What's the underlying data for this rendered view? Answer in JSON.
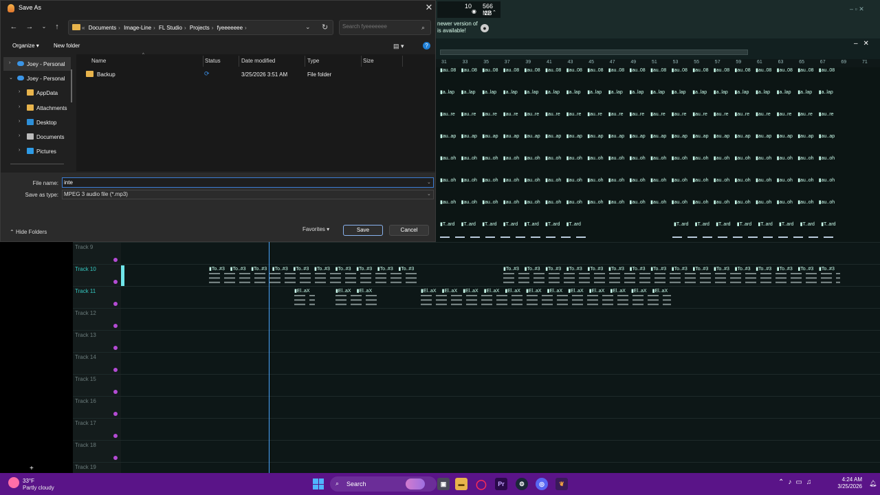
{
  "dialog": {
    "title": "Save As",
    "address": {
      "crumbs": [
        "Documents",
        "Image-Line",
        "FL Studio",
        "Projects",
        "fyeeeeeee"
      ],
      "prefix": "«"
    },
    "search_placeholder": "Search fyeeeeeee",
    "toolbar": {
      "organize": "Organize",
      "new_folder": "New folder"
    },
    "nav": [
      {
        "label": "Joey - Personal",
        "icon": "onedrive-cloud-icon"
      },
      {
        "label": "Joey - Personal",
        "icon": "onedrive-cloud-icon"
      },
      {
        "label": "AppData",
        "icon": "folder-icon"
      },
      {
        "label": "Attachments",
        "icon": "folder-icon"
      },
      {
        "label": "Desktop",
        "icon": "desktop-icon"
      },
      {
        "label": "Documents",
        "icon": "documents-icon"
      },
      {
        "label": "Pictures",
        "icon": "pictures-icon"
      }
    ],
    "columns": {
      "name": "Name",
      "status": "Status",
      "date": "Date modified",
      "type": "Type",
      "size": "Size"
    },
    "files": [
      {
        "name": "Backup",
        "date": "3/25/2026 3:51 AM",
        "type": "File folder",
        "size": ""
      }
    ],
    "file_name_label": "File name:",
    "file_name_value": "inte",
    "save_type_label": "Save as type:",
    "save_type_value": "MPEG 3 audio file (*.mp3)",
    "hide_folders": "Hide Folders",
    "favorites": "Favorites",
    "save": "Save",
    "cancel": "Cancel"
  },
  "fl": {
    "cpu_value": "10",
    "ram_value": "566 MB",
    "voices": "12",
    "update_line1": "newer version of",
    "update_line2": "is available!",
    "ruler": [
      "31",
      "33",
      "35",
      "37",
      "39",
      "41",
      "43",
      "45",
      "47",
      "49",
      "51",
      "53",
      "55",
      "57",
      "59",
      "61",
      "63",
      "65",
      "67",
      "69",
      "71"
    ],
    "clip_rows": [
      {
        "clip": "au..08"
      },
      {
        "clip": "a..lap"
      },
      {
        "clip": "au..re"
      },
      {
        "clip": "au..ap"
      },
      {
        "clip": "au..oh"
      },
      {
        "clip": "au..oh"
      },
      {
        "clip": "au..oh"
      },
      {
        "clip": "T..ard"
      },
      {
        "clip": "To..#2"
      }
    ],
    "tracks": [
      {
        "label": "Track 9"
      },
      {
        "label": "Track 10"
      },
      {
        "label": "Track 11"
      },
      {
        "label": "Track 12"
      },
      {
        "label": "Track 13"
      },
      {
        "label": "Track 14"
      },
      {
        "label": "Track 15"
      },
      {
        "label": "Track 16"
      },
      {
        "label": "Track 17"
      },
      {
        "label": "Track 18"
      },
      {
        "label": "Track 19"
      }
    ],
    "track10_clip": "To..#3",
    "track11_clip": "El..aX"
  },
  "taskbar": {
    "temperature": "33°F",
    "condition": "Partly cloudy",
    "search_label": "Search",
    "time": "4:24 AM",
    "date": "3/25/2026",
    "apps": [
      "task-view-icon",
      "file-explorer-icon",
      "opera-gx-icon",
      "premiere-pro-icon",
      "steam-icon",
      "discord-icon",
      "fl-studio-icon"
    ]
  },
  "colors": {
    "taskbar": "#5a1488",
    "accent": "#3b7ed6",
    "track_highlight": "#35c8c0",
    "playhead": "#4aa6ff"
  }
}
